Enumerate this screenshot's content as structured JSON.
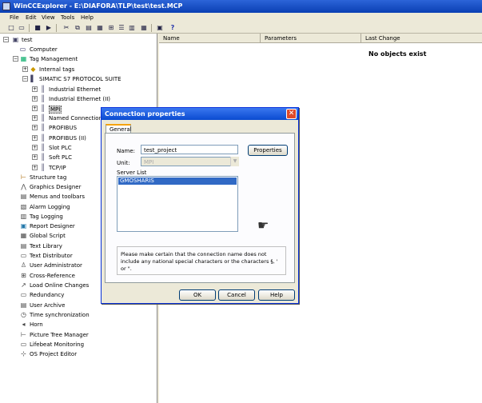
{
  "window": {
    "title": "WinCCExplorer - E:\\DIAFORA\\TLP\\test\\test.MCP"
  },
  "menu": [
    "File",
    "Edit",
    "View",
    "Tools",
    "Help"
  ],
  "toolbar": {
    "help_glyph": "?"
  },
  "tree": {
    "root": "test",
    "items": [
      {
        "label": "Computer"
      },
      {
        "label": "Tag Management"
      },
      {
        "label": "Internal tags"
      },
      {
        "label": "SIMATIC S7 PROTOCOL SUITE"
      },
      {
        "label": "Industrial Ethernet"
      },
      {
        "label": "Industrial Ethernet (II)"
      },
      {
        "label": "MPI"
      },
      {
        "label": "Named Connections"
      },
      {
        "label": "PROFIBUS"
      },
      {
        "label": "PROFIBUS (II)"
      },
      {
        "label": "Slot PLC"
      },
      {
        "label": "Soft PLC"
      },
      {
        "label": "TCP/IP"
      },
      {
        "label": "Structure tag"
      },
      {
        "label": "Graphics Designer"
      },
      {
        "label": "Menus and toolbars"
      },
      {
        "label": "Alarm Logging"
      },
      {
        "label": "Tag Logging"
      },
      {
        "label": "Report Designer"
      },
      {
        "label": "Global Script"
      },
      {
        "label": "Text Library"
      },
      {
        "label": "Text Distributor"
      },
      {
        "label": "User Administrator"
      },
      {
        "label": "Cross-Reference"
      },
      {
        "label": "Load Online Changes"
      },
      {
        "label": "Redundancy"
      },
      {
        "label": "User Archive"
      },
      {
        "label": "Time synchronization"
      },
      {
        "label": "Horn"
      },
      {
        "label": "Picture Tree Manager"
      },
      {
        "label": "Lifebeat Monitoring"
      },
      {
        "label": "OS Project Editor"
      }
    ]
  },
  "list": {
    "columns": [
      "Name",
      "Parameters",
      "Last Change"
    ],
    "empty_message": "No objects exist"
  },
  "dialog": {
    "title": "Connection properties",
    "close_glyph": "✕",
    "tab": "General",
    "name_label": "Name:",
    "name_value": "test_project",
    "properties_button": "Properties",
    "unit_label": "Unit:",
    "unit_value": "MPI",
    "server_list_label": "Server List",
    "server_list": [
      "GMOSHARIS"
    ],
    "note": "Please make certain that the connection name does not include any national special characters or the characters §, ' or \".",
    "ok": "OK",
    "cancel": "Cancel",
    "help": "Help"
  }
}
